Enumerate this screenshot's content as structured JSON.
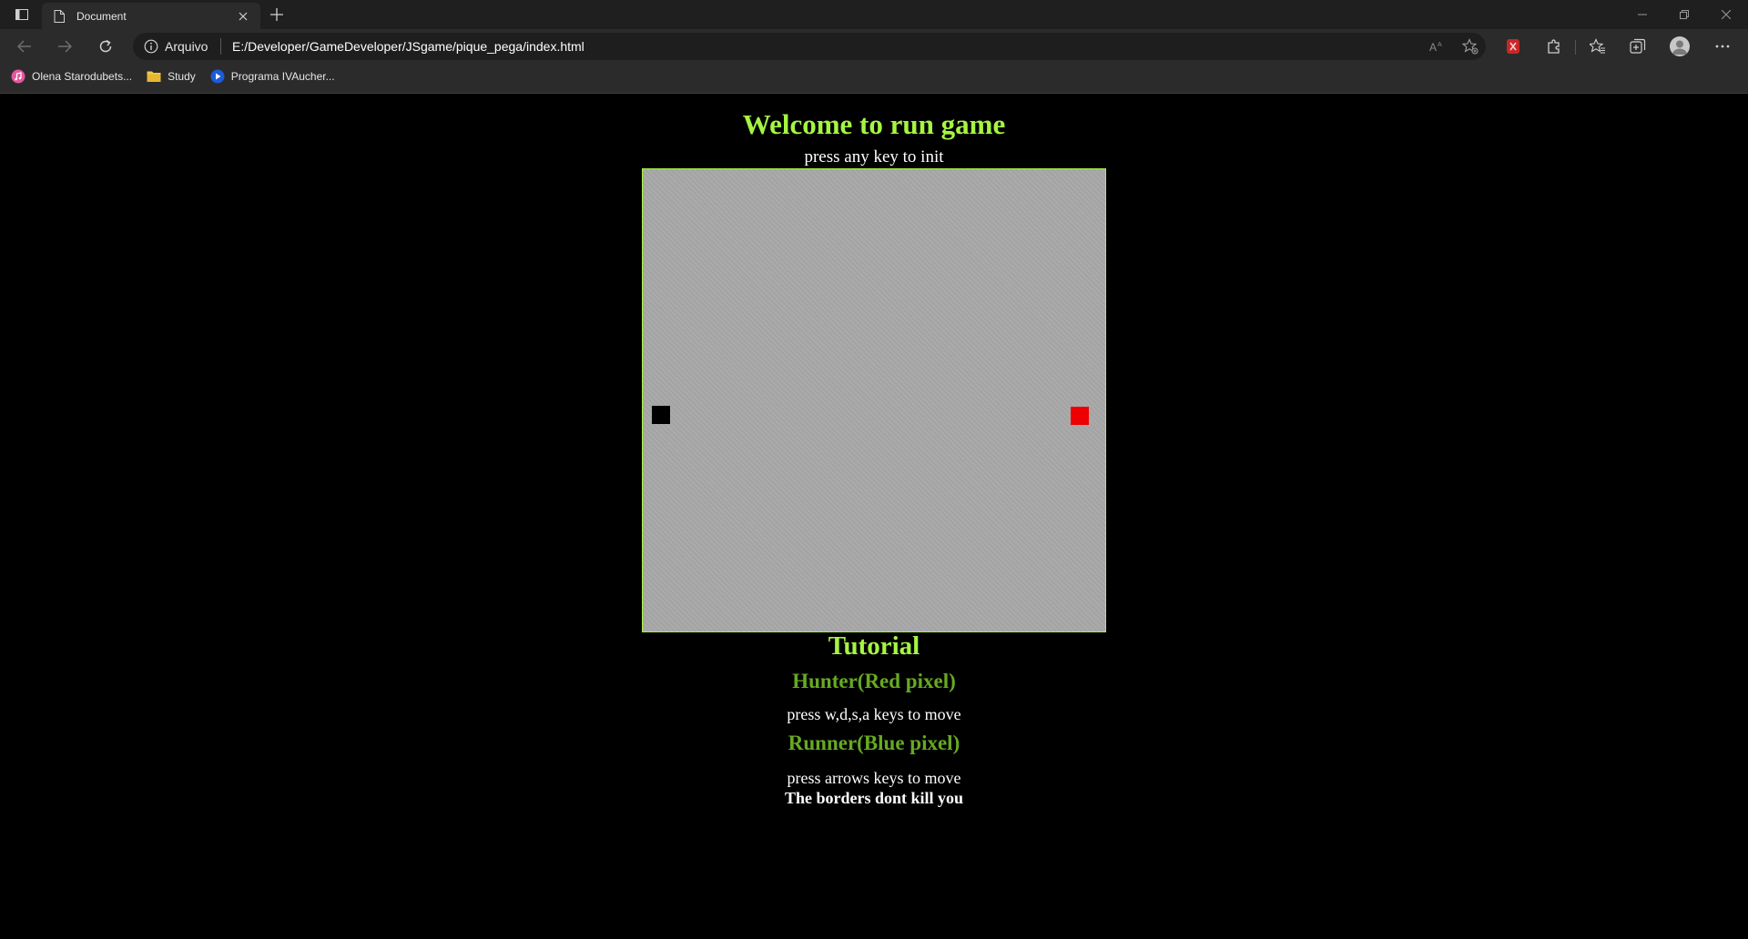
{
  "browser": {
    "tab_title": "Document",
    "site_label": "Arquivo",
    "url": "E:/Developer/GameDeveloper/JSgame/pique_pega/index.html",
    "bookmarks": [
      {
        "label": "Olena Starodubets...",
        "icon": "music-app-icon"
      },
      {
        "label": "Study",
        "icon": "folder-icon"
      },
      {
        "label": "Programa IVAucher...",
        "icon": "play-circle-icon"
      }
    ]
  },
  "page": {
    "title": "Welcome to run game",
    "subtitle": "press any key to init",
    "game": {
      "board_color": "#a8a8a8",
      "border_color": "#a6f542",
      "runner_color": "#000000",
      "hunter_color": "#ee0000"
    },
    "tutorial": {
      "title": "Tutorial",
      "hunter_heading": "Hunter(Red pixel)",
      "hunter_keys": "press w,d,s,a keys to move",
      "runner_heading": "Runner(Blue pixel)",
      "runner_keys": "press arrows keys to move",
      "borders_note": "The borders dont kill you"
    }
  }
}
